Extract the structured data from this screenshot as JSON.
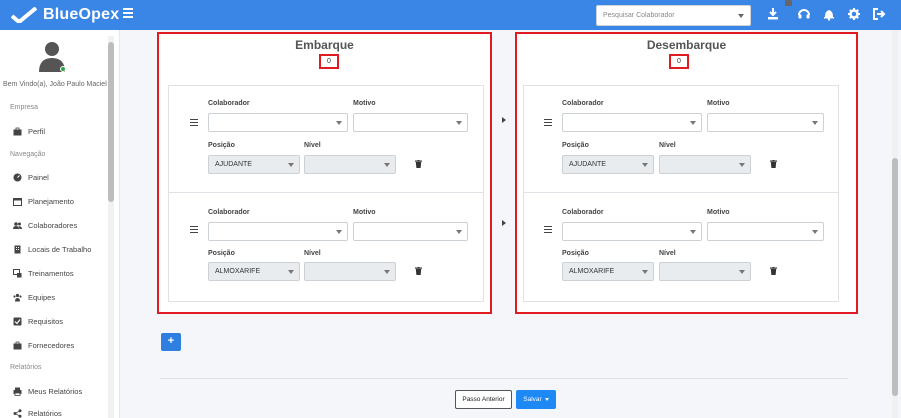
{
  "app": {
    "name": "BlueOpex"
  },
  "header": {
    "search_placeholder": "Pesquisar Colaborador",
    "icons": [
      "download-icon",
      "headset-icon",
      "bell-icon",
      "gear-icon",
      "logout-icon"
    ]
  },
  "sidebar": {
    "welcome": "Bem Vindo(a), João Paulo Maciel",
    "sections": {
      "empresa": "Empresa",
      "navegacao": "Navegação",
      "relatorios": "Relatórios"
    },
    "items": {
      "perfil": "Perfil",
      "painel": "Painel",
      "planejamento": "Planejamento",
      "colaboradores": "Colaboradores",
      "locais": "Locais de Trabalho",
      "treinamentos": "Treinamentos",
      "equipes": "Equipes",
      "requisitos": "Requisitos",
      "fornecedores": "Fornecedores",
      "meus_relatorios": "Meus Relatórios",
      "relatorios": "Relatórios"
    }
  },
  "labels": {
    "colaborador": "Colaborador",
    "motivo": "Motivo",
    "posicao": "Posição",
    "nivel": "Nível"
  },
  "embarque": {
    "title": "Embarque",
    "count": "0",
    "rows": [
      {
        "posicao": "AJUDANTE"
      },
      {
        "posicao": "ALMOXARIFE"
      }
    ]
  },
  "desembarque": {
    "title": "Desembarque",
    "count": "0",
    "rows": [
      {
        "posicao": "AJUDANTE"
      },
      {
        "posicao": "ALMOXARIFE"
      }
    ]
  },
  "actions": {
    "add": "+",
    "previous": "Passo Anterior",
    "save": "Salvar"
  },
  "colors": {
    "topbar": "#3a86e6",
    "highlight": "#e11b22",
    "primary": "#1e88f5"
  }
}
